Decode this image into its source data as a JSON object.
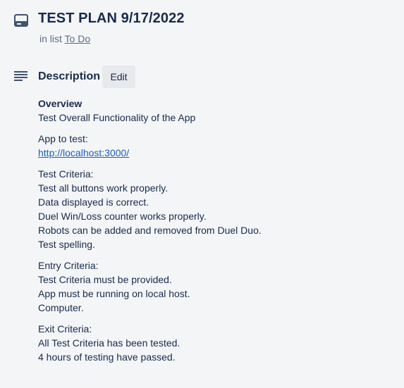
{
  "card": {
    "title": "TEST PLAN 9/17/2022",
    "icon": "card-icon",
    "in_list_prefix": "in list",
    "list_name": "To Do"
  },
  "description": {
    "heading": "Description",
    "icon": "description-icon",
    "edit_label": "Edit",
    "overview_heading": "Overview",
    "overview_text": "Test Overall Functionality of the App",
    "app_label": "App to test:",
    "app_link": "http://localhost:3000/",
    "test_criteria_label": "Test Criteria:",
    "test_criteria": [
      "Test all buttons work properly.",
      "Data displayed is correct.",
      "Duel Win/Loss counter works properly.",
      "Robots can be added and removed from Duel Duo.",
      "Test spelling."
    ],
    "entry_criteria_label": "Entry Criteria:",
    "entry_criteria": [
      "Test Criteria must be provided.",
      "App must be running on local host.",
      "Computer."
    ],
    "exit_criteria_label": "Exit Criteria:",
    "exit_criteria": [
      "All Test Criteria has been tested.",
      "4 hours of testing have passed."
    ]
  },
  "colors": {
    "background": "#f4f5f7",
    "text": "#172b4d",
    "muted": "#5e6c84",
    "button_bg": "#e7e9ed",
    "link": "#1d5fb8",
    "icon": "#42526e"
  }
}
